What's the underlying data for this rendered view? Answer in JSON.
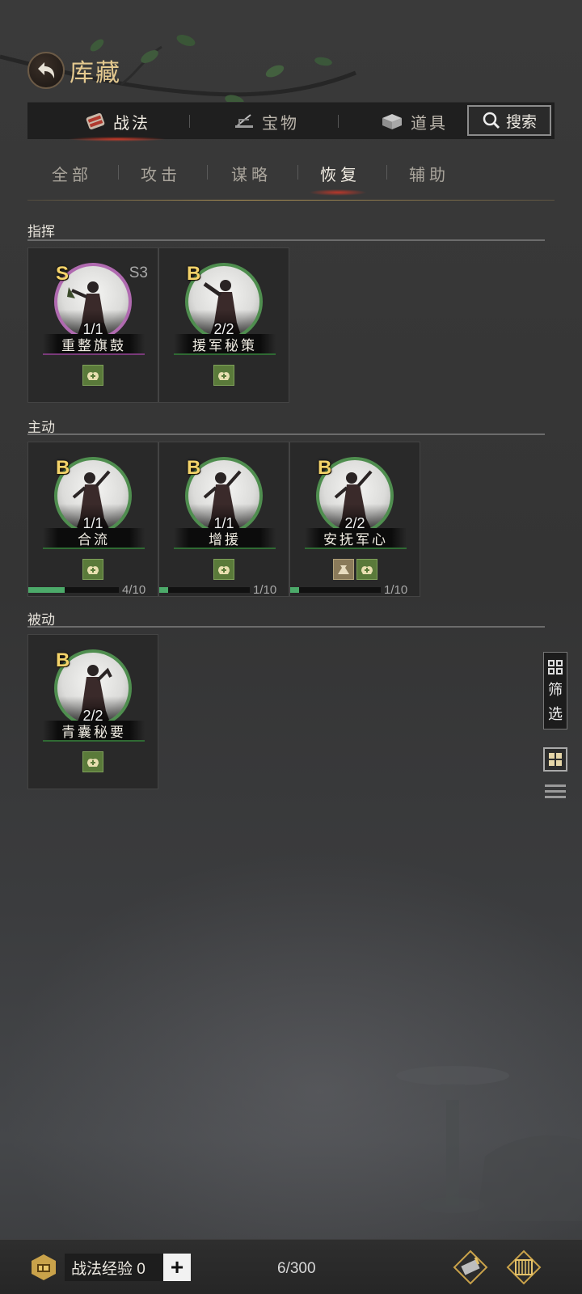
{
  "header": {
    "title": "库藏"
  },
  "main_tabs": [
    {
      "label": "战法",
      "icon": "scroll-bundle-icon",
      "active": true
    },
    {
      "label": "宝物",
      "icon": "treasure-icon",
      "active": false
    },
    {
      "label": "道具",
      "icon": "item-box-icon",
      "active": false
    }
  ],
  "search": {
    "label": "搜索"
  },
  "sub_tabs": [
    {
      "label": "全部",
      "active": false
    },
    {
      "label": "攻击",
      "active": false
    },
    {
      "label": "谋略",
      "active": false
    },
    {
      "label": "恢复",
      "active": true
    },
    {
      "label": "辅助",
      "active": false
    }
  ],
  "sections": [
    {
      "title": "指挥",
      "cards": [
        {
          "grade": "S",
          "season": "S3",
          "count": "1/1",
          "name": "重整旗鼓",
          "types": [
            "heal"
          ]
        },
        {
          "grade": "B",
          "season": "",
          "count": "2/2",
          "name": "援军秘策",
          "types": [
            "heal"
          ]
        }
      ]
    },
    {
      "title": "主动",
      "cards": [
        {
          "grade": "B",
          "season": "",
          "count": "1/1",
          "name": "合流",
          "types": [
            "heal"
          ],
          "progress_text": "4/10",
          "progress": 0.4
        },
        {
          "grade": "B",
          "season": "",
          "count": "1/1",
          "name": "增援",
          "types": [
            "heal"
          ],
          "progress_text": "1/10",
          "progress": 0.1
        },
        {
          "grade": "B",
          "season": "",
          "count": "2/2",
          "name": "安抚军心",
          "types": [
            "bag",
            "heal"
          ],
          "progress_text": "1/10",
          "progress": 0.1
        }
      ]
    },
    {
      "title": "被动",
      "cards": [
        {
          "grade": "B",
          "season": "",
          "count": "2/2",
          "name": "青囊秘要",
          "types": [
            "heal"
          ]
        }
      ]
    }
  ],
  "side": {
    "filter_label_1": "筛",
    "filter_label_2": "选"
  },
  "bottom": {
    "exp_label": "战法经验 0",
    "plus": "+",
    "capacity": "6/300"
  }
}
